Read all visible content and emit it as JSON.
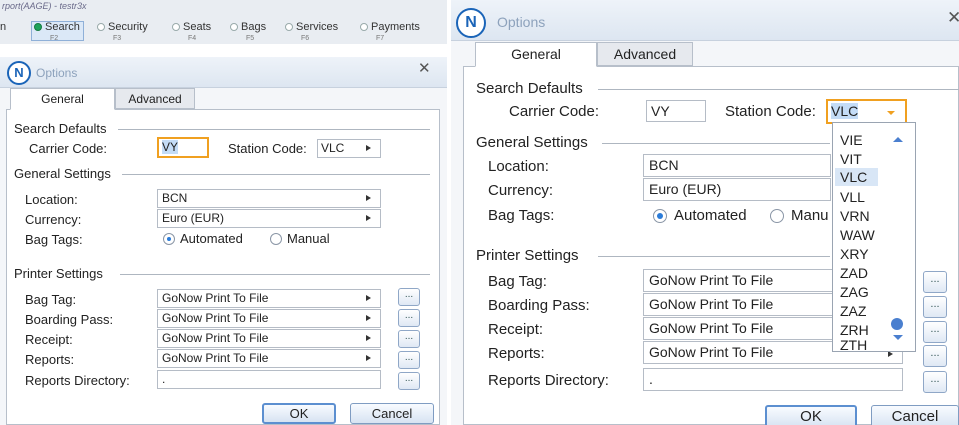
{
  "left": {
    "app_title": "rport(AAGE) - testr3x",
    "nav": [
      {
        "label": "n",
        "key": ""
      },
      {
        "label": "Search",
        "key": "F2"
      },
      {
        "label": "Security",
        "key": "F3"
      },
      {
        "label": "Seats",
        "key": "F4"
      },
      {
        "label": "Bags",
        "key": "F5"
      },
      {
        "label": "Services",
        "key": "F6"
      },
      {
        "label": "Payments",
        "key": "F7"
      }
    ],
    "dialog_title": "Options",
    "close_glyph": "✕",
    "logo_letter": "N",
    "tabs": [
      "General",
      "Advanced"
    ],
    "search_defaults": {
      "group": "Search Defaults",
      "carrier_label": "Carrier Code:",
      "carrier_value": "VY",
      "station_label": "Station Code:",
      "station_value": "VLC"
    },
    "general_settings": {
      "group": "General Settings",
      "location_label": "Location:",
      "location_value": "BCN",
      "currency_label": "Currency:",
      "currency_value": "Euro (EUR)",
      "bagtags_label": "Bag Tags:",
      "automated": "Automated",
      "manual": "Manual"
    },
    "printer_settings": {
      "group": "Printer Settings",
      "rows": [
        {
          "label": "Bag Tag:",
          "value": "GoNow Print To File"
        },
        {
          "label": "Boarding Pass:",
          "value": "GoNow Print To File"
        },
        {
          "label": "Receipt:",
          "value": "GoNow Print To File"
        },
        {
          "label": "Reports:",
          "value": "GoNow Print To File"
        }
      ],
      "dir_label": "Reports Directory:",
      "dir_value": ".",
      "dots": "..."
    },
    "ok": "OK",
    "cancel": "Cancel"
  },
  "right": {
    "dialog_title": "Options",
    "close_glyph": "✕",
    "logo_letter": "N",
    "tabs": [
      "General",
      "Advanced"
    ],
    "search_defaults": {
      "group": "Search Defaults",
      "carrier_label": "Carrier Code:",
      "carrier_value": "VY",
      "station_label": "Station Code:",
      "station_value": "VLC"
    },
    "station_options": [
      "VIE",
      "VIT",
      "VLC",
      "VLL",
      "VRN",
      "WAW",
      "XRY",
      "ZAD",
      "ZAG",
      "ZAZ",
      "ZRH",
      "ZTH"
    ],
    "station_selected": "VLC",
    "general_settings": {
      "group": "General Settings",
      "location_label": "Location:",
      "location_value": "BCN",
      "currency_label": "Currency:",
      "currency_value": "Euro (EUR)",
      "bagtags_label": "Bag Tags:",
      "automated": "Automated",
      "manual": "Manu"
    },
    "printer_settings": {
      "group": "Printer Settings",
      "rows": [
        {
          "label": "Bag Tag:",
          "value": "GoNow Print To File"
        },
        {
          "label": "Boarding Pass:",
          "value": "GoNow Print To File"
        },
        {
          "label": "Receipt:",
          "value": "GoNow Print To File"
        },
        {
          "label": "Reports:",
          "value": "GoNow Print To File"
        }
      ],
      "dir_label": "Reports Directory:",
      "dir_value": ".",
      "dots": "..."
    },
    "ok": "OK",
    "cancel": "Cancel"
  },
  "colors": {
    "accent": "#1a64b8",
    "focus_border": "#f0a020",
    "selection": "#c4dcf6",
    "radio_on": "#2b7cd9"
  }
}
